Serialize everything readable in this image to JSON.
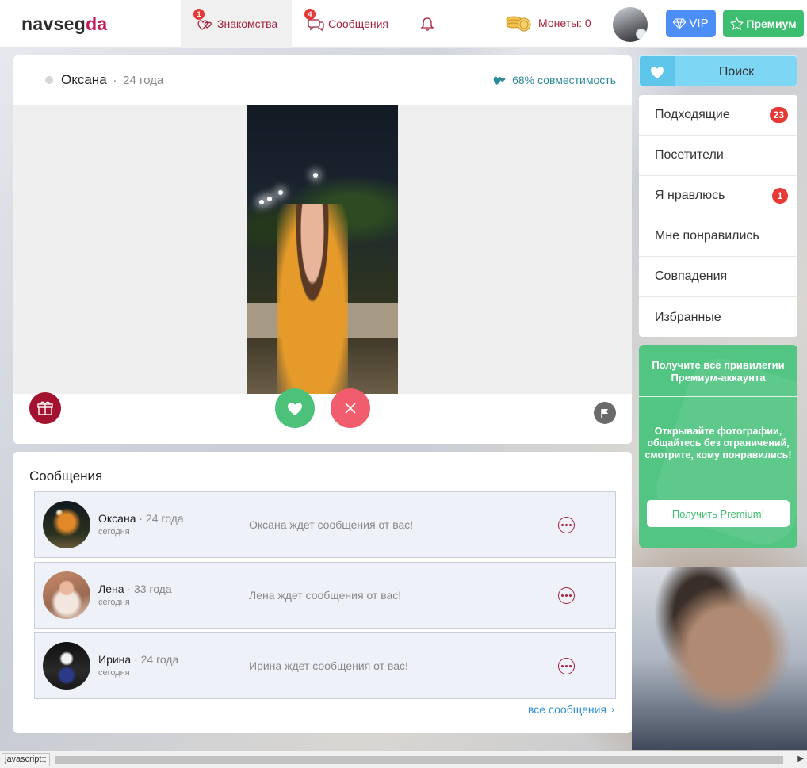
{
  "logo": {
    "part1": "navseg",
    "part2": "da"
  },
  "nav": {
    "dating": {
      "label": "Знакомства",
      "badge": "1"
    },
    "messages": {
      "label": "Сообщения",
      "badge": "4"
    }
  },
  "coins": {
    "label": "Монеты: 0"
  },
  "buttons": {
    "vip": "VIP",
    "premium": "Премиум"
  },
  "profile": {
    "name": "Оксана",
    "separator": "·",
    "age": "24 года",
    "compatibility": "68% совместимость"
  },
  "messages": {
    "title": "Сообщения",
    "items": [
      {
        "name": "Оксана",
        "age": "· 24 года",
        "time": "сегодня",
        "text": "Оксана ждет сообщения от вас!"
      },
      {
        "name": "Лена",
        "age": "· 33 года",
        "time": "сегодня",
        "text": "Лена ждет сообщения от вас!"
      },
      {
        "name": "Ирина",
        "age": "· 24 года",
        "time": "сегодня",
        "text": "Ирина ждет сообщения от вас!"
      }
    ],
    "all_link": "все сообщения",
    "chevron": "›"
  },
  "sidebar": {
    "search": "Поиск",
    "items": [
      {
        "label": "Подходящие",
        "badge": "23"
      },
      {
        "label": "Посетители",
        "badge": null
      },
      {
        "label": "Я нравлюсь",
        "badge": "1"
      },
      {
        "label": "Мне понравились",
        "badge": null
      },
      {
        "label": "Совпадения",
        "badge": null
      },
      {
        "label": "Избранные",
        "badge": null
      }
    ]
  },
  "promo": {
    "title": "Получите все привилегии Премиум-аккаунта",
    "text": "Открывайте фотографии, общайтесь без ограничений, смотрите, кому понравились!",
    "button": "Получить Premium!"
  },
  "statusbar": {
    "text": "javascript:;"
  },
  "colors": {
    "brand": "#a3213f",
    "accent_green": "#3dbd6f",
    "vip_blue": "#4c8df6",
    "link_blue": "#2f8fd6"
  }
}
